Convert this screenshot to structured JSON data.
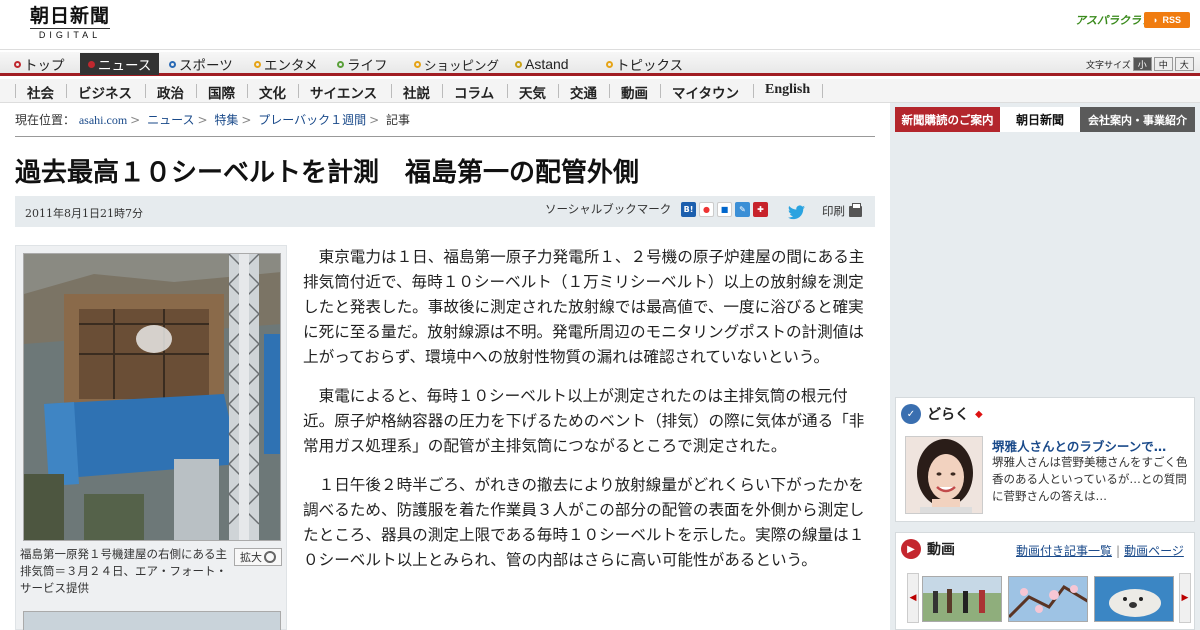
{
  "header": {
    "logo_jp": "朝日新聞",
    "logo_en": "DIGITAL",
    "asupara": "アスパラクラブ",
    "rss": "RSS"
  },
  "nav_primary": [
    {
      "label": "トップ",
      "color": "#c0282f"
    },
    {
      "label": "ニュース",
      "color": "#c0282f",
      "active": true
    },
    {
      "label": "スポーツ",
      "color": "#2a6ab5"
    },
    {
      "label": "エンタメ",
      "color": "#e6a417"
    },
    {
      "label": "ライフ",
      "color": "#5aa03a"
    },
    {
      "label": "ショッピング",
      "color": "#e6a417"
    },
    {
      "label": "Astand",
      "color": "#c9a31a"
    },
    {
      "label": "トピックス",
      "color": "#e6a417"
    }
  ],
  "font_size": {
    "label": "文字サイズ",
    "options": [
      "小",
      "中",
      "大"
    ],
    "selected": "小"
  },
  "nav_categories": [
    "社会",
    "ビジネス",
    "政治",
    "国際",
    "文化",
    "サイエンス",
    "社説",
    "コラム",
    "天気",
    "交通",
    "動画",
    "マイタウン",
    "English"
  ],
  "breadcrumb": {
    "prefix": "現在位置：",
    "items": [
      "asahi.com",
      "ニュース",
      "特集",
      "プレーバック１週間",
      "記事"
    ]
  },
  "article": {
    "title": "過去最高１０シーベルトを計測　福島第一の配管外側",
    "date": "2011年8月1日21時7分",
    "social_label": "ソーシャルブックマーク",
    "print_label": "印刷",
    "paragraphs": [
      "東京電力は１日、福島第一原子力発電所１、２号機の原子炉建屋の間にある主排気筒付近で、毎時１０シーベルト（１万ミリシーベルト）以上の放射線を測定したと発表した。事故後に測定された放射線では最高値で、一度に浴びると確実に死に至る量だ。放射線源は不明。発電所周辺のモニタリングポストの計測値は上がっておらず、環境中への放射性物質の漏れは確認されていないという。",
      "東電によると、毎時１０シーベルト以上が測定されたのは主排気筒の根元付近。原子炉格納容器の圧力を下げるためのベント（排気）の際に気体が通る「非常用ガス処理系」の配管が主排気筒につながるところで測定された。",
      "１日午後２時半ごろ、がれきの撤去により放射線量がどれくらい下がったかを調べるため、防護服を着た作業員３人がこの部分の配管の表面を外側から測定したところ、器具の測定上限である毎時１０シーベルトを示した。実際の線量は１０シーベルト以上とみられ、管の内部はさらに高い可能性があるという。"
    ],
    "photo_caption": "福島第一原発１号機建屋の右側にある主排気筒＝３月２４日、エア・フォート・サービス提供",
    "zoom_label": "拡大"
  },
  "sidebar": {
    "banner": {
      "left": "新聞購読のご案内",
      "center": "朝日新聞",
      "right": "会社案内・事業紹介"
    },
    "doraku": {
      "heading": "どらく",
      "title": "堺雅人さんとのラブシーンで…",
      "body": "堺雅人さんは菅野美穂さんをすごく色香のある人といっているが…との質問に菅野さんの答えは…"
    },
    "video": {
      "heading": "動画",
      "link1": "動画付き記事一覧",
      "link2": "動画ページ"
    }
  },
  "colors": {
    "accent_red": "#a11d23",
    "link_blue": "#1a4a8a"
  }
}
